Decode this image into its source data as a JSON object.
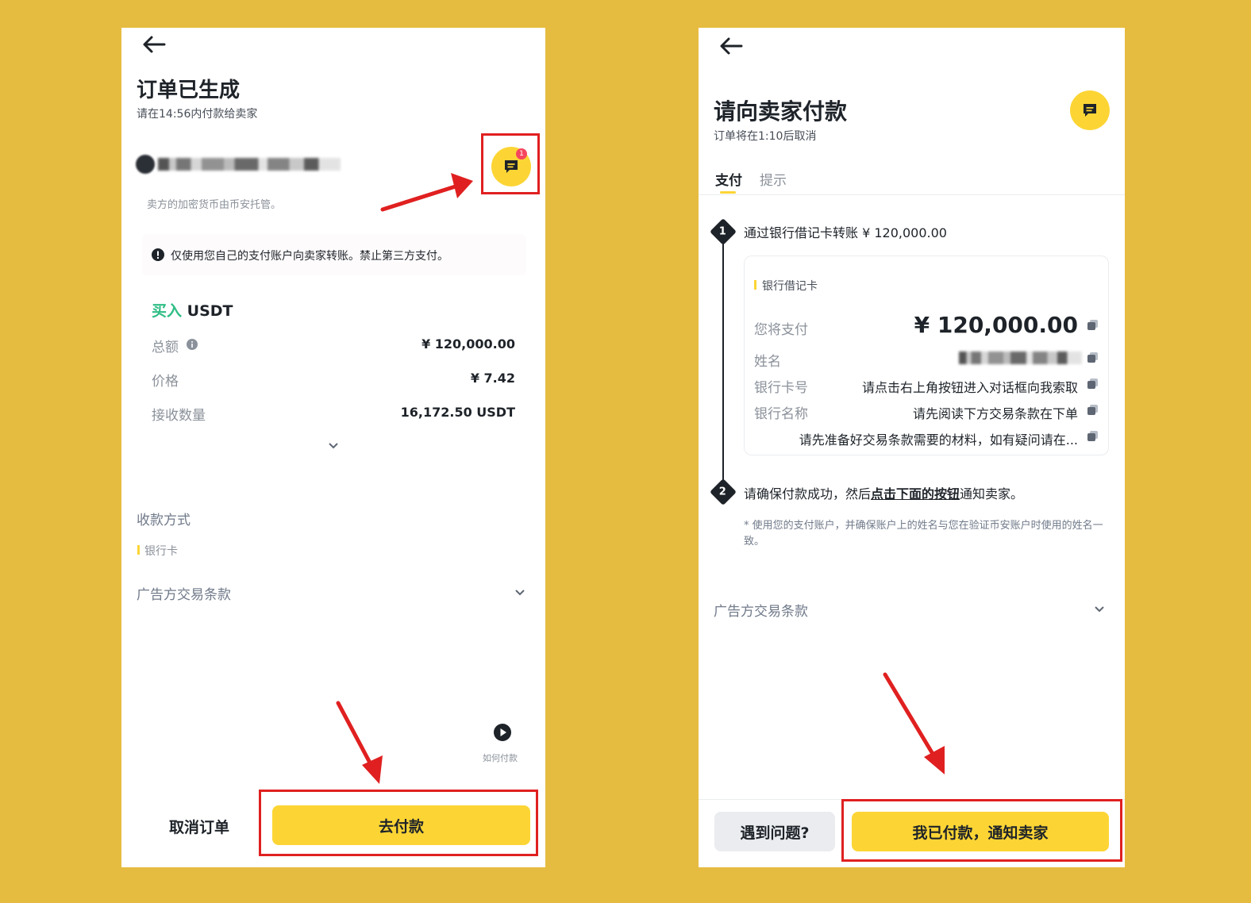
{
  "left": {
    "title": "订单已生成",
    "subtitle": "请在14:56内付款给卖家",
    "chat_badge": "1",
    "escrow_note": "卖方的加密货币由币安托管。",
    "warning": "仅使用您自己的支付账户向卖家转账。禁止第三方支付。",
    "buy_word": "买入",
    "asset": "USDT",
    "rows": [
      {
        "label": "总额",
        "value": "¥ 120,000.00"
      },
      {
        "label": "价格",
        "value": "¥ 7.42"
      },
      {
        "label": "接收数量",
        "value": "16,172.50 USDT"
      }
    ],
    "payment_method_label": "收款方式",
    "payment_method_value": "银行卡",
    "terms_label": "广告方交易条款",
    "how_to_pay": "如何付款",
    "cancel_label": "取消订单",
    "pay_label": "去付款"
  },
  "right": {
    "title": "请向卖家付款",
    "subtitle": "订单将在1:10后取消",
    "tabs": [
      "支付",
      "提示"
    ],
    "step1_num": "1",
    "step1_text": "通过银行借记卡转账 ¥ 120,000.00",
    "card_type": "银行借记卡",
    "pay_amount_label": "您将支付",
    "pay_amount_value": "¥ 120,000.00",
    "name_label": "姓名",
    "account_label": "银行卡号",
    "account_value": "请点击右上角按钮进入对话框向我索取",
    "bank_label": "银行名称",
    "bank_value": "请先阅读下方交易条款在下单",
    "extra_value": "请先准备好交易条款需要的材料，如有疑问请在...",
    "step2_num": "2",
    "step2_prefix": "请确保付款成功，然后",
    "step2_link": "点击下面的按钮",
    "step2_suffix": "通知卖家。",
    "note": "* 使用您的支付账户，并确保账户上的姓名与您在验证币安账户时使用的姓名一致。",
    "terms_label": "广告方交易条款",
    "problem_label": "遇到问题?",
    "paid_label": "我已付款，通知卖家"
  },
  "colors": {
    "background": "#e6bc40",
    "accent": "#fcd535",
    "buy_green": "#2ebd85",
    "annotation_red": "#e02020"
  }
}
